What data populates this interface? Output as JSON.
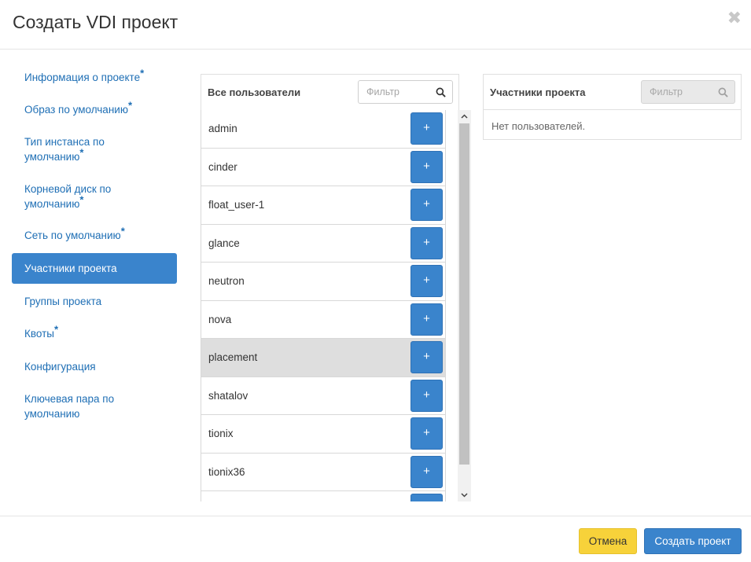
{
  "modal": {
    "title": "Создать VDI проект",
    "close_symbol": "✖"
  },
  "sidebar": {
    "items": [
      {
        "label": "Информация о проекте",
        "required": true,
        "active": false
      },
      {
        "label": "Образ по умолчанию",
        "required": true,
        "active": false
      },
      {
        "label_line1": "Тип инстанса по",
        "label_line2": "умолчанию",
        "required": true,
        "active": false
      },
      {
        "label_line1": "Корневой диск по",
        "label_line2": "умолчанию",
        "required": true,
        "active": false
      },
      {
        "label": "Сеть по умолчанию",
        "required": true,
        "active": false
      },
      {
        "label": "Участники проекта",
        "required": false,
        "active": true
      },
      {
        "label": "Группы проекта",
        "required": false,
        "active": false
      },
      {
        "label": "Квоты",
        "required": true,
        "active": false
      },
      {
        "label": "Конфигурация",
        "required": false,
        "active": false
      },
      {
        "label_line1": "Ключевая пара по",
        "label_line2": "умолчанию",
        "required": false,
        "active": false
      }
    ],
    "required_mark": "*"
  },
  "all_users": {
    "title": "Все пользователи",
    "filter_placeholder": "Фильтр",
    "add_label": "+",
    "users": [
      "admin",
      "cinder",
      "float_user-1",
      "glance",
      "neutron",
      "nova",
      "placement",
      "shatalov",
      "tionix",
      "tionix36"
    ],
    "hovered_user": "placement"
  },
  "members": {
    "title": "Участники проекта",
    "filter_placeholder": "Фильтр",
    "empty_text": "Нет пользователей."
  },
  "footer": {
    "cancel_label": "Отмена",
    "submit_label": "Создать проект"
  },
  "colors": {
    "accent": "#3a84cc",
    "cancel": "#f7d23a",
    "link": "#1f6fb5"
  },
  "icons": {
    "filter": "search-icon",
    "close": "close-icon",
    "scroll_up": "chevron-up-icon",
    "scroll_down": "chevron-down-icon"
  }
}
